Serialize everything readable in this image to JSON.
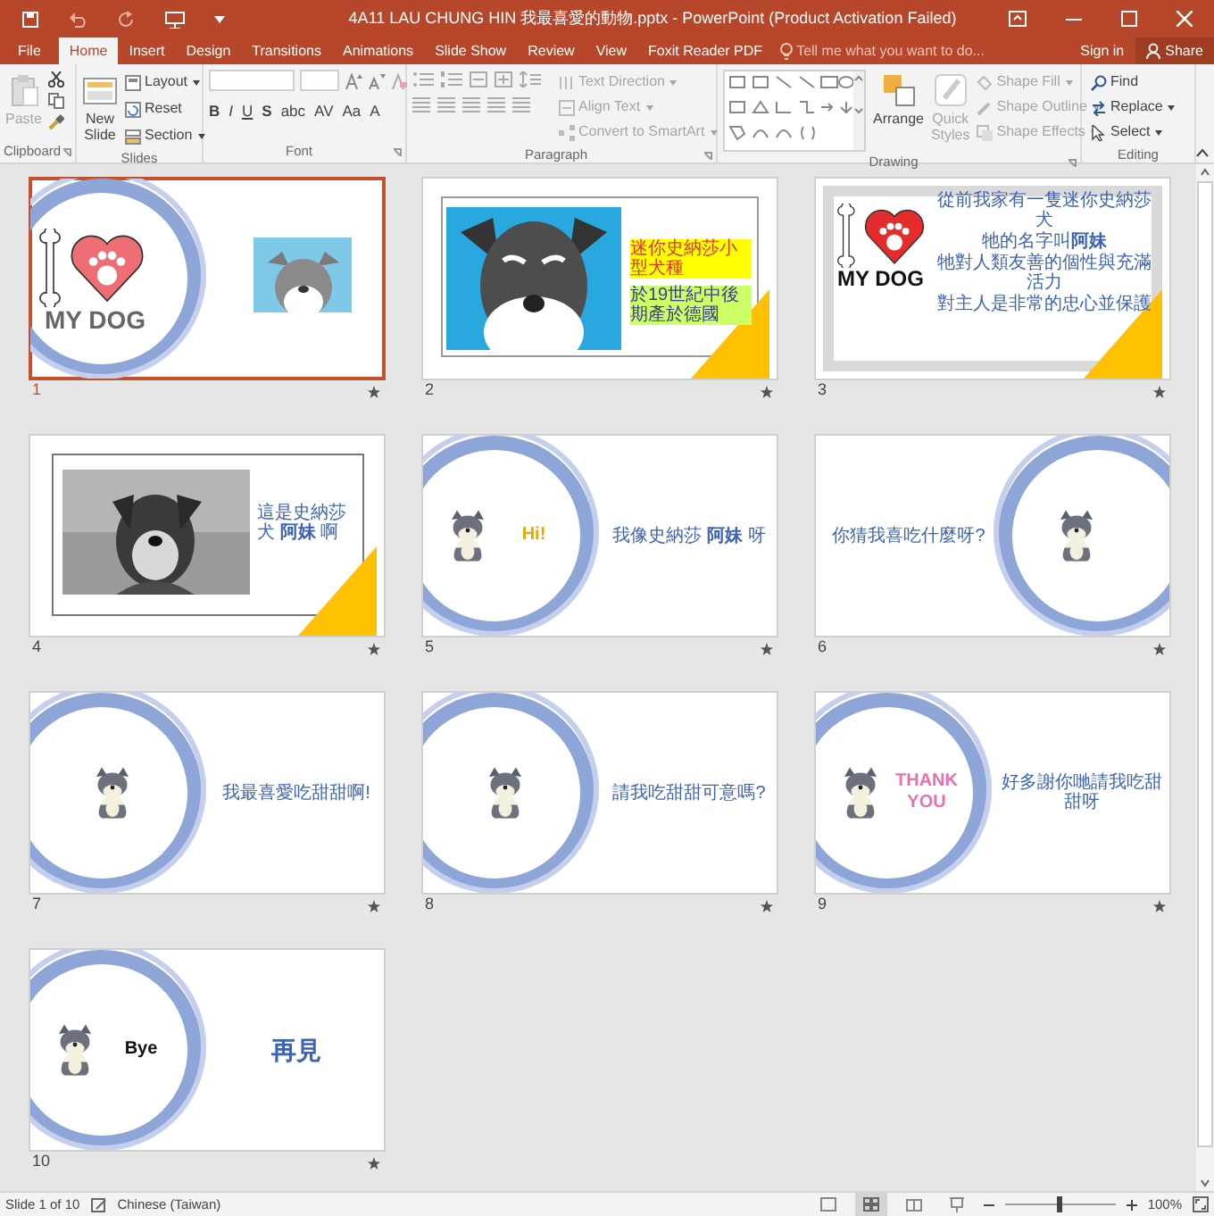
{
  "window": {
    "title": "4A11 LAU CHUNG HIN 我最喜愛的動物.pptx - PowerPoint (Product Activation Failed)"
  },
  "tabs": [
    {
      "label": "File",
      "selected": false
    },
    {
      "label": "Home",
      "selected": true
    },
    {
      "label": "Insert",
      "selected": false
    },
    {
      "label": "Design",
      "selected": false
    },
    {
      "label": "Transitions",
      "selected": false
    },
    {
      "label": "Animations",
      "selected": false
    },
    {
      "label": "Slide Show",
      "selected": false
    },
    {
      "label": "Review",
      "selected": false
    },
    {
      "label": "View",
      "selected": false
    },
    {
      "label": "Foxit Reader PDF",
      "selected": false
    }
  ],
  "tell_me": {
    "placeholder": "Tell me what you want to do..."
  },
  "account": {
    "sign_in": "Sign in",
    "share": "Share"
  },
  "ribbon": [
    {
      "kind": "clipboard",
      "title": "Clipboard",
      "controls": [
        {
          "label": "Paste",
          "disabled": true
        }
      ]
    },
    {
      "kind": "slides",
      "title": "Slides",
      "controls": [
        {
          "label": "New Slide",
          "disabled": false
        },
        {
          "label": "Layout",
          "disabled": false
        },
        {
          "label": "Reset",
          "disabled": false
        },
        {
          "label": "Section",
          "disabled": false
        }
      ]
    },
    {
      "kind": "font",
      "title": "Font",
      "controls": [
        {
          "label": "B",
          "disabled": false
        },
        {
          "label": "I",
          "disabled": false
        },
        {
          "label": "U",
          "disabled": false
        },
        {
          "label": "S",
          "disabled": false
        },
        {
          "label": "abc",
          "disabled": false
        },
        {
          "label": "AV",
          "disabled": false
        },
        {
          "label": "Aa",
          "disabled": false
        },
        {
          "label": "A",
          "disabled": false
        }
      ]
    },
    {
      "kind": "paragraph",
      "title": "Paragraph",
      "controls": [
        {
          "label": "Text Direction",
          "disabled": true
        },
        {
          "label": "Align Text",
          "disabled": true
        },
        {
          "label": "Convert to SmartArt",
          "disabled": true
        }
      ]
    },
    {
      "kind": "drawing",
      "title": "Drawing",
      "controls": [
        {
          "label": "Arrange",
          "disabled": false
        },
        {
          "label": "Quick Styles",
          "disabled": true
        },
        {
          "label": "Shape Fill",
          "disabled": true
        },
        {
          "label": "Shape Outline",
          "disabled": true
        },
        {
          "label": "Shape Effects",
          "disabled": true
        }
      ]
    },
    {
      "kind": "editing",
      "title": "Editing",
      "controls": [
        {
          "label": "Find",
          "disabled": false
        },
        {
          "label": "Replace",
          "disabled": false
        },
        {
          "label": "Select",
          "disabled": false
        }
      ]
    }
  ],
  "slides": [
    {
      "number": "1",
      "selected": true,
      "kind": "title",
      "heading": "MY DOG"
    },
    {
      "number": "2",
      "selected": false,
      "kind": "cartoon_frame",
      "lines": [
        {
          "text": "迷你史納莎小型犬種",
          "color": "#ffff00"
        },
        {
          "text": "於19世紀中後期產於德國",
          "color": "#ccff66"
        }
      ]
    },
    {
      "number": "3",
      "selected": false,
      "kind": "heart_frame",
      "heading": "MY DOG",
      "lines": [
        "從前我家有一隻迷你史納莎犬",
        "牠的名字叫**阿妹**",
        "牠對人類友善的個性與充滿活力",
        "對主人是非常的忠心並保護"
      ]
    },
    {
      "number": "4",
      "selected": false,
      "kind": "photo_frame",
      "lines": [
        "這是史納莎犬 **阿妹** 啊"
      ]
    },
    {
      "number": "5",
      "selected": false,
      "kind": "circle_left",
      "sticker": "Hi!",
      "lines": [
        "我像史納莎 **阿妹** 呀"
      ]
    },
    {
      "number": "6",
      "selected": false,
      "kind": "circle_right",
      "lines": [
        "你猜我喜吃什麼呀?"
      ]
    },
    {
      "number": "7",
      "selected": false,
      "kind": "circle_left",
      "lines": [
        "我最喜愛吃甜甜啊!"
      ]
    },
    {
      "number": "8",
      "selected": false,
      "kind": "circle_left",
      "lines": [
        "請我吃甜甜可意嗎?"
      ]
    },
    {
      "number": "9",
      "selected": false,
      "kind": "circle_left",
      "sticker": "THANK YOU",
      "lines": [
        "好多謝你哋請我吃甜甜呀"
      ]
    },
    {
      "number": "10",
      "selected": false,
      "kind": "circle_left",
      "sticker": "Bye",
      "title": "再見"
    }
  ],
  "status_bar": {
    "slide": "Slide 1 of 10",
    "language": "Chinese (Taiwan)",
    "views": [
      {
        "selected": false
      },
      {
        "selected": true
      },
      {
        "selected": false
      },
      {
        "selected": false
      }
    ],
    "zoom": {
      "level": 0.5,
      "reading": "100%"
    }
  }
}
